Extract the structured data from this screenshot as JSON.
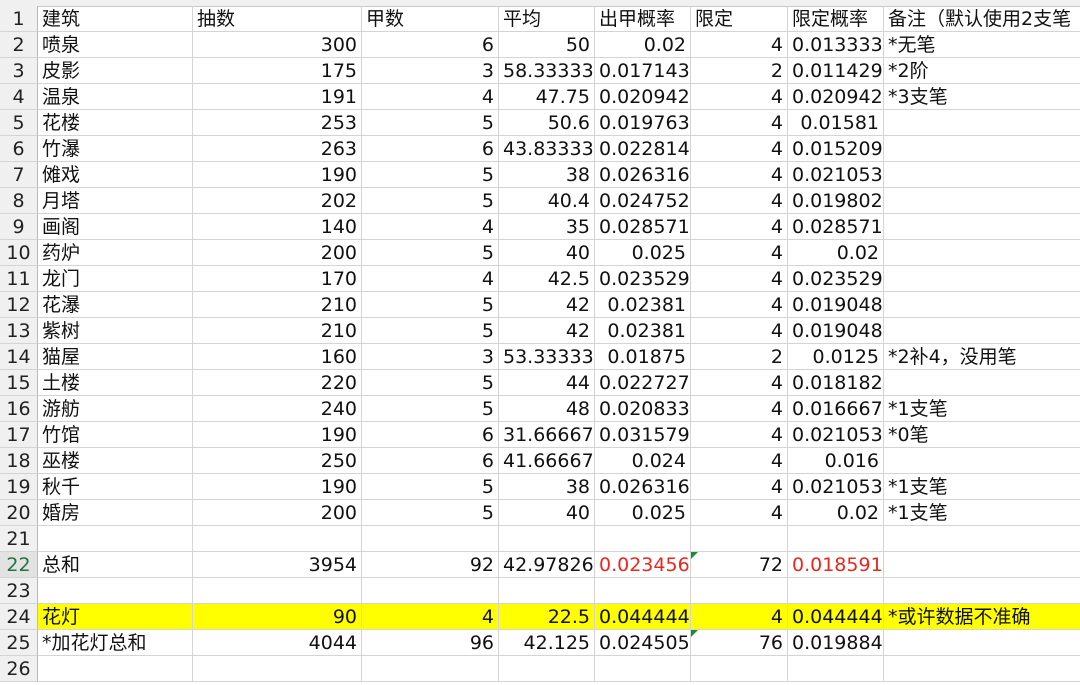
{
  "headers": {
    "row_num": "1",
    "col_b": "建筑",
    "col_c": "抽数",
    "col_d": "甲数",
    "col_e": "平均",
    "col_f": "出甲概率",
    "col_g": "限定",
    "col_h": "限定概率",
    "col_i": "备注（默认使用2支笔"
  },
  "rows": [
    {
      "n": "2",
      "b": "喷泉",
      "c": "300",
      "d": "6",
      "e": "50",
      "f": "0.02",
      "g": "4",
      "h": "0.013333",
      "i": "*无笔"
    },
    {
      "n": "3",
      "b": "皮影",
      "c": "175",
      "d": "3",
      "e": "58.33333",
      "f": "0.017143",
      "g": "2",
      "h": "0.011429",
      "i": "*2阶"
    },
    {
      "n": "4",
      "b": "温泉",
      "c": "191",
      "d": "4",
      "e": "47.75",
      "f": "0.020942",
      "g": "4",
      "h": "0.020942",
      "i": "*3支笔"
    },
    {
      "n": "5",
      "b": "花楼",
      "c": "253",
      "d": "5",
      "e": "50.6",
      "f": "0.019763",
      "g": "4",
      "h": "0.01581",
      "i": ""
    },
    {
      "n": "6",
      "b": "竹瀑",
      "c": "263",
      "d": "6",
      "e": "43.83333",
      "f": "0.022814",
      "g": "4",
      "h": "0.015209",
      "i": ""
    },
    {
      "n": "7",
      "b": "傩戏",
      "c": "190",
      "d": "5",
      "e": "38",
      "f": "0.026316",
      "g": "4",
      "h": "0.021053",
      "i": ""
    },
    {
      "n": "8",
      "b": "月塔",
      "c": "202",
      "d": "5",
      "e": "40.4",
      "f": "0.024752",
      "g": "4",
      "h": "0.019802",
      "i": ""
    },
    {
      "n": "9",
      "b": "画阁",
      "c": "140",
      "d": "4",
      "e": "35",
      "f": "0.028571",
      "g": "4",
      "h": "0.028571",
      "i": ""
    },
    {
      "n": "10",
      "b": "药炉",
      "c": "200",
      "d": "5",
      "e": "40",
      "f": "0.025",
      "g": "4",
      "h": "0.02",
      "i": ""
    },
    {
      "n": "11",
      "b": "龙门",
      "c": "170",
      "d": "4",
      "e": "42.5",
      "f": "0.023529",
      "g": "4",
      "h": "0.023529",
      "i": ""
    },
    {
      "n": "12",
      "b": "花瀑",
      "c": "210",
      "d": "5",
      "e": "42",
      "f": "0.02381",
      "g": "4",
      "h": "0.019048",
      "i": ""
    },
    {
      "n": "13",
      "b": "紫树",
      "c": "210",
      "d": "5",
      "e": "42",
      "f": "0.02381",
      "g": "4",
      "h": "0.019048",
      "i": ""
    },
    {
      "n": "14",
      "b": "猫屋",
      "c": "160",
      "d": "3",
      "e": "53.33333",
      "f": "0.01875",
      "g": "2",
      "h": "0.0125",
      "i": "*2补4，没用笔"
    },
    {
      "n": "15",
      "b": "土楼",
      "c": "220",
      "d": "5",
      "e": "44",
      "f": "0.022727",
      "g": "4",
      "h": "0.018182",
      "i": ""
    },
    {
      "n": "16",
      "b": "游舫",
      "c": "240",
      "d": "5",
      "e": "48",
      "f": "0.020833",
      "g": "4",
      "h": "0.016667",
      "i": "*1支笔"
    },
    {
      "n": "17",
      "b": "竹馆",
      "c": "190",
      "d": "6",
      "e": "31.66667",
      "f": "0.031579",
      "g": "4",
      "h": "0.021053",
      "i": "*0笔"
    },
    {
      "n": "18",
      "b": "巫楼",
      "c": "250",
      "d": "6",
      "e": "41.66667",
      "f": "0.024",
      "g": "4",
      "h": "0.016",
      "i": ""
    },
    {
      "n": "19",
      "b": "秋千",
      "c": "190",
      "d": "5",
      "e": "38",
      "f": "0.026316",
      "g": "4",
      "h": "0.021053",
      "i": "*1支笔"
    },
    {
      "n": "20",
      "b": "婚房",
      "c": "200",
      "d": "5",
      "e": "40",
      "f": "0.025",
      "g": "4",
      "h": "0.02",
      "i": "*1支笔"
    }
  ],
  "row21": "21",
  "total": {
    "n": "22",
    "b": "总和",
    "c": "3954",
    "d": "92",
    "e": "42.97826",
    "f": "0.023456",
    "g": "72",
    "h": "0.018591",
    "i": ""
  },
  "row23": "23",
  "lantern": {
    "n": "24",
    "b": "花灯",
    "c": "90",
    "d": "4",
    "e": "22.5",
    "f": "0.044444",
    "g": "4",
    "h": "0.044444",
    "i": "*或许数据不准确"
  },
  "total_with_lantern": {
    "n": "25",
    "b": "*加花灯总和",
    "c": "4044",
    "d": "96",
    "e": "42.125",
    "f": "0.024505",
    "g": "76",
    "h": "0.019884",
    "i": ""
  },
  "row26": "26",
  "colors": {
    "highlight": "#ffff00",
    "red_text": "#e8281e",
    "selected_header": "#217346"
  }
}
